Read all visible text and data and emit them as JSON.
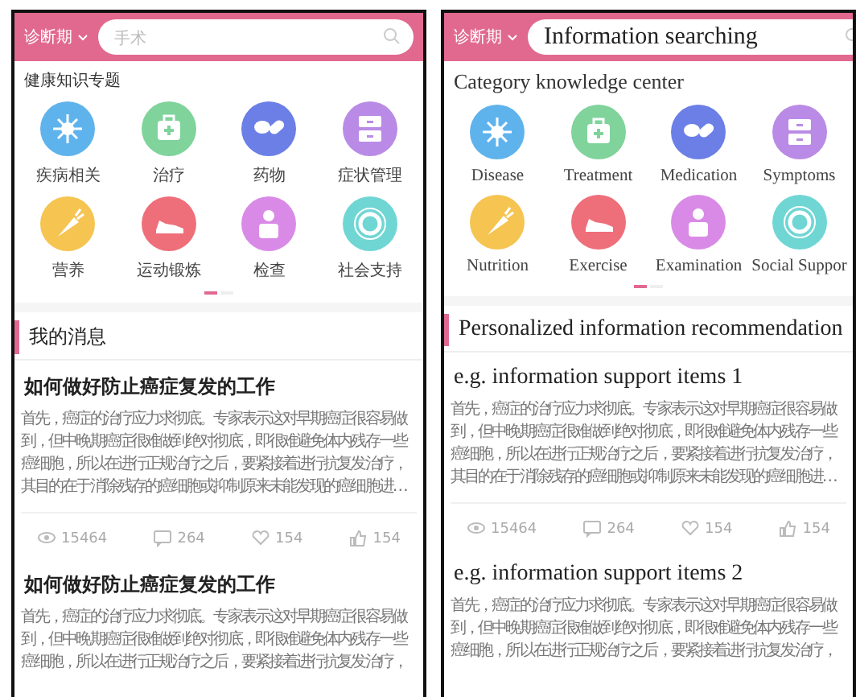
{
  "screens": [
    {
      "kind": "chinese",
      "header": {
        "period": "诊断期",
        "search": {
          "placeholder": "手术"
        }
      },
      "category_title": "健康知识专题",
      "categories": [
        {
          "label": "疾病相关",
          "kind": "virus",
          "color": "#5fb3ec"
        },
        {
          "label": "治疗",
          "kind": "kit",
          "color": "#7fd39b"
        },
        {
          "label": "药物",
          "kind": "pills",
          "color": "#6b7fe6"
        },
        {
          "label": "症状管理",
          "kind": "cabinet",
          "color": "#b98be6"
        },
        {
          "label": "营养",
          "kind": "carrot",
          "color": "#f5c451"
        },
        {
          "label": "运动锻炼",
          "kind": "shoe",
          "color": "#ee6f7a"
        },
        {
          "label": "检查",
          "kind": "doctor",
          "color": "#d98ae6"
        },
        {
          "label": "社会支持",
          "kind": "ring",
          "color": "#6fd6d4"
        }
      ],
      "pages": [
        {
          "selected": true
        },
        {
          "selected": false
        }
      ],
      "section_title": "我的消息",
      "articles": [
        {
          "title": "如何做好防止癌症复发的工作",
          "body": "首先，癌症的治疗应力求彻底。专家表示这对早期癌症很容易做到，但中晚期癌症很难做到绝对彻底，即很难避免体内残存一些癌细胞，所以在进行正规治疗之后，要紧接着进行抗复发治疗，其目的在于消除残存的癌细胞或抑制原来未能发现的癌细胞进…",
          "stats": {
            "views": "15464",
            "comments": "264",
            "favorites": "154",
            "likes": "154"
          }
        },
        {
          "title": "如何做好防止癌症复发的工作",
          "body": "首先，癌症的治疗应力求彻底。专家表示这对早期癌症很容易做到，但中晚期癌症很难做到绝对彻底，即很难避免体内残存一些癌细胞，所以在进行正规治疗之后，要紧接着进行抗复发治疗，"
        }
      ]
    },
    {
      "kind": "english",
      "header": {
        "period": "诊断期",
        "search": {
          "value": "Information searching"
        }
      },
      "category_title": "Category knowledge center",
      "categories": [
        {
          "label": "Disease",
          "kind": "virus",
          "color": "#5fb3ec"
        },
        {
          "label": "Treatment",
          "kind": "kit",
          "color": "#7fd39b"
        },
        {
          "label": "Medication",
          "kind": "pills",
          "color": "#6b7fe6"
        },
        {
          "label": "Symptoms",
          "kind": "cabinet",
          "color": "#b98be6"
        },
        {
          "label": "Nutrition",
          "kind": "carrot",
          "color": "#f5c451"
        },
        {
          "label": "Exercise",
          "kind": "shoe",
          "color": "#ee6f7a"
        },
        {
          "label": "Examination",
          "kind": "doctor",
          "color": "#d98ae6"
        },
        {
          "label": "Social Suppor",
          "kind": "ring",
          "color": "#6fd6d4"
        }
      ],
      "pages": [
        {
          "selected": true
        },
        {
          "selected": false
        }
      ],
      "section_title": "Personalized information recommendation",
      "articles": [
        {
          "title": "e.g. information support items 1",
          "body": "首先，癌症的治疗应力求彻底。专家表示这对早期癌症很容易做到，但中晚期癌症很难做到绝对彻底，即很难避免体内残存一些癌细胞，所以在进行正规治疗之后，要紧接着进行抗复发治疗，其目的在于消除残存的癌细胞或抑制原来未能发现的癌细胞进…",
          "stats": {
            "views": "15464",
            "comments": "264",
            "favorites": "154",
            "likes": "154"
          }
        },
        {
          "title": "e.g. information support items 2",
          "body": "首先，癌症的治疗应力求彻底。专家表示这对早期癌症很容易做到，但中晚期癌症很难做到绝对彻底，即很难避免体内残存一些癌细胞，所以在进行正规治疗之后，要紧接着进行抗复发治疗，"
        }
      ]
    }
  ]
}
